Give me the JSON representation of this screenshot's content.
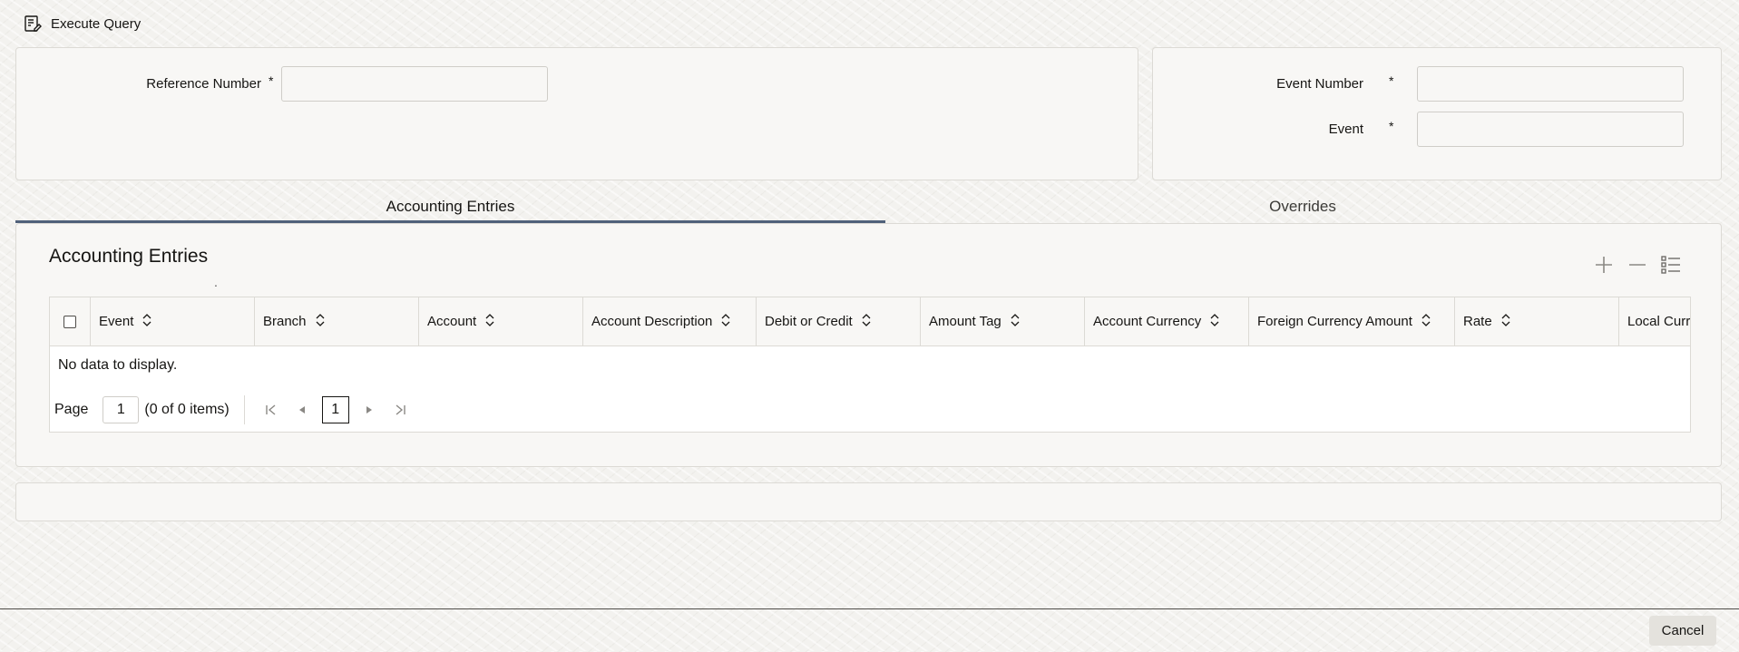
{
  "toolbar": {
    "execute_query_label": "Execute Query"
  },
  "form": {
    "reference_number_label": "Reference Number",
    "event_number_label": "Event Number",
    "event_label": "Event",
    "required_marker": "*",
    "reference_number_value": "",
    "event_number_value": "",
    "event_value": ""
  },
  "tabs": [
    {
      "label": "Accounting Entries",
      "active": true
    },
    {
      "label": "Overrides",
      "active": false
    }
  ],
  "section": {
    "title": "Accounting Entries",
    "dot": "."
  },
  "table": {
    "columns": [
      "Event",
      "Branch",
      "Account",
      "Account Description",
      "Debit or Credit",
      "Amount Tag",
      "Account Currency",
      "Foreign Currency Amount",
      "Rate",
      "Local Curr"
    ],
    "no_data_text": "No data to display."
  },
  "pagination": {
    "page_label": "Page",
    "page_value": "1",
    "items_text": "(0 of 0 items)",
    "current_page": "1"
  },
  "footer": {
    "cancel_label": "Cancel"
  },
  "colors": {
    "accent": "#50617a",
    "background": "#f3f2ef",
    "panel": "#f8f7f5"
  }
}
